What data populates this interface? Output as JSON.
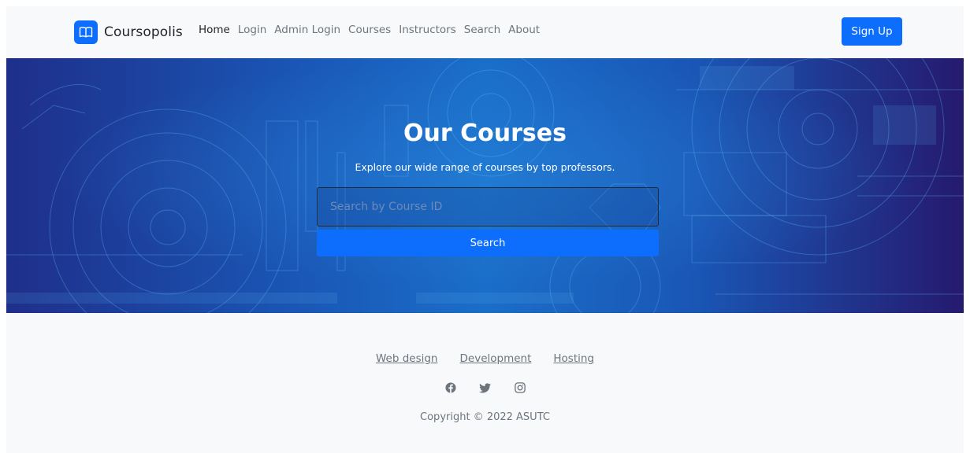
{
  "navbar": {
    "brand": "Coursopolis",
    "links": [
      {
        "label": "Home",
        "active": true
      },
      {
        "label": "Login",
        "active": false
      },
      {
        "label": "Admin Login",
        "active": false
      },
      {
        "label": "Courses",
        "active": false
      },
      {
        "label": "Instructors",
        "active": false
      },
      {
        "label": "Search",
        "active": false
      },
      {
        "label": "About",
        "active": false
      }
    ],
    "signup_label": "Sign Up"
  },
  "hero": {
    "title": "Our Courses",
    "subtitle": "Explore our wide range of courses by top professors.",
    "search_placeholder": "Search by Course ID",
    "search_value": "",
    "search_button": "Search"
  },
  "footer": {
    "links": [
      "Web design",
      "Development",
      "Hosting"
    ],
    "social_icons": [
      "facebook-icon",
      "twitter-icon",
      "instagram-icon"
    ],
    "copyright": "Copyright © 2022 ASUTC"
  },
  "colors": {
    "primary": "#0d6efd",
    "page_bg": "#f8f9fa",
    "muted_text": "#6c757d",
    "hero_dark": "#1e2f8a",
    "hero_light": "#1a6ec8"
  }
}
